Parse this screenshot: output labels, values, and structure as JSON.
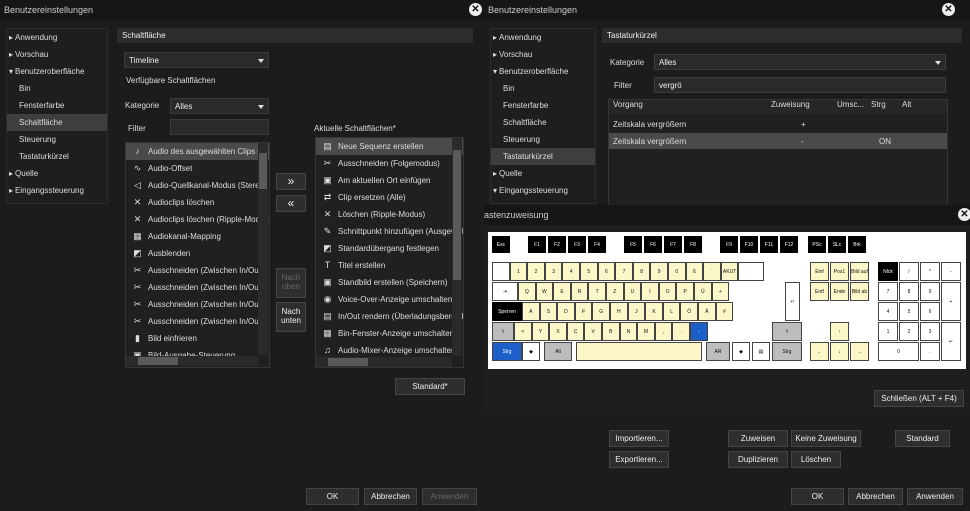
{
  "left_dialog": {
    "title": "Benutzereinstellungen",
    "nav": [
      {
        "label": "Anwendung",
        "level": 0,
        "arrow": "▸"
      },
      {
        "label": "Vorschau",
        "level": 0,
        "arrow": "▸"
      },
      {
        "label": "Benutzeroberfläche",
        "level": 0,
        "arrow": "▾"
      },
      {
        "label": "Bin",
        "level": 1
      },
      {
        "label": "Fensterfarbe",
        "level": 1
      },
      {
        "label": "Schaltfläche",
        "level": 1,
        "selected": true
      },
      {
        "label": "Steuerung",
        "level": 1
      },
      {
        "label": "Tastaturkürzel",
        "level": 1
      },
      {
        "label": "Quelle",
        "level": 0,
        "arrow": "▸"
      },
      {
        "label": "Eingangssteuerung",
        "level": 0,
        "arrow": "▸"
      }
    ],
    "section_title": "Schaltfläche",
    "timeline_combo": "Timeline",
    "available_label": "Verfügbare Schaltflächen",
    "category_label": "Kategorie",
    "category_value": "Alles",
    "filter_label": "Filter",
    "filter_value": "",
    "available_items": [
      {
        "label": "Audio des ausgewählten Clips ersetzen",
        "icon": "♪"
      },
      {
        "label": "Audio-Offset",
        "icon": "∿"
      },
      {
        "label": "Audio-Quellkanal-Modus (Stereo)",
        "icon": "◁"
      },
      {
        "label": "Audioclips löschen",
        "icon": "✕"
      },
      {
        "label": "Audioclips löschen (Ripple-Modus)",
        "icon": "✕"
      },
      {
        "label": "Audiokanal-Mapping",
        "icon": "▦"
      },
      {
        "label": "Ausblenden",
        "icon": "◩"
      },
      {
        "label": "Ausschneiden (Zwischen In/Out)",
        "icon": "✂"
      },
      {
        "label": "Ausschneiden (Zwischen In/Out)",
        "icon": "✂"
      },
      {
        "label": "Ausschneiden (Zwischen In/Out)",
        "icon": "✂"
      },
      {
        "label": "Ausschneiden (Zwischen In/Out)",
        "icon": "✂"
      },
      {
        "label": "Bild einfrieren",
        "icon": "▮"
      },
      {
        "label": "Bild-Ausgabe-Steuerung",
        "icon": "▣"
      }
    ],
    "move_right": "»",
    "move_left": "«",
    "move_up": "Nach oben",
    "move_down": "Nach unten",
    "current_label": "Aktuelle Schaltflächen*",
    "current_items": [
      {
        "label": "Neue Sequenz erstellen",
        "icon": "▤"
      },
      {
        "label": "Ausschneiden (Folgemodus)",
        "icon": "✂"
      },
      {
        "label": "Am aktuellen Ort einfügen",
        "icon": "▣"
      },
      {
        "label": "Clip ersetzen (Alle)",
        "icon": "⇄"
      },
      {
        "label": "Löschen (Ripple-Modus)",
        "icon": "✕"
      },
      {
        "label": "Schnittpunkt hinzufügen (Ausgewählte Spur)",
        "icon": "✎"
      },
      {
        "label": "Standardübergang festlegen",
        "icon": "◩"
      },
      {
        "label": "Titel erstellen",
        "icon": "T"
      },
      {
        "label": "Standbild erstellen (Speichern)",
        "icon": "▣"
      },
      {
        "label": "Voice-Over-Anzeige umschalten",
        "icon": "◉"
      },
      {
        "label": "In/Out rendern (Überladungsbereich)",
        "icon": "▤"
      },
      {
        "label": "Bin-Fenster-Anzeige umschalten",
        "icon": "▦"
      },
      {
        "label": "Audio-Mixer-Anzeige umschalten",
        "icon": "♫"
      }
    ],
    "standard_button": "Standard*",
    "ok": "OK",
    "cancel": "Abbrechen",
    "apply": "Anwenden"
  },
  "right_dialog": {
    "title": "Benutzereinstellungen",
    "nav": [
      {
        "label": "Anwendung",
        "level": 0,
        "arrow": "▸"
      },
      {
        "label": "Vorschau",
        "level": 0,
        "arrow": "▸"
      },
      {
        "label": "Benutzeroberfläche",
        "level": 0,
        "arrow": "▾"
      },
      {
        "label": "Bin",
        "level": 1
      },
      {
        "label": "Fensterfarbe",
        "level": 1
      },
      {
        "label": "Schaltfläche",
        "level": 1
      },
      {
        "label": "Steuerung",
        "level": 1
      },
      {
        "label": "Tastaturkürzel",
        "level": 1,
        "selected": true
      },
      {
        "label": "Quelle",
        "level": 0,
        "arrow": "▸"
      },
      {
        "label": "Eingangssteuerung",
        "level": 0,
        "arrow": "▾"
      }
    ],
    "section_title": "Tastaturkürzel",
    "category_label": "Kategorie",
    "category_value": "Alles",
    "filter_label": "Filter",
    "filter_value": "vergrö",
    "table_headers": [
      "Vorgang",
      "Zuweisung",
      "Umsc...",
      "Strg",
      "Alt"
    ],
    "table_rows": [
      {
        "action": "Zeitskala vergrößern",
        "assign": "+",
        "shift": "",
        "ctrl": "",
        "alt": ""
      },
      {
        "action": "Zeitskala vergrößern",
        "assign": "-",
        "shift": "",
        "ctrl": "ON",
        "alt": ""
      }
    ],
    "import_btn": "Importieren...",
    "export_btn": "Exportieren...",
    "assign_btn": "Zuweisen",
    "no_assign_btn": "Keine Zuweisung",
    "duplicate_btn": "Duplizieren",
    "delete_btn": "Löschen",
    "standard_btn": "Standard",
    "ok": "OK",
    "cancel": "Abbrechen",
    "apply": "Anwenden"
  },
  "key_dialog": {
    "title": "astenzuweisung",
    "close_btn": "Schließen (ALT + F4)",
    "fn_row": [
      "Esc",
      "F1",
      "F2",
      "F3",
      "F4",
      "F5",
      "F6",
      "F7",
      "F8",
      "F9",
      "F10",
      "F11",
      "F12",
      "PSc",
      "SLc",
      "Brk"
    ],
    "row1": [
      "",
      "1",
      "2",
      "3",
      "4",
      "5",
      "6",
      "7",
      "8",
      "9",
      "0",
      "ß",
      "´",
      "AKUT",
      ""
    ],
    "row2": [
      "⇥",
      "Q",
      "W",
      "E",
      "R",
      "T",
      "Z",
      "U",
      "I",
      "O",
      "P",
      "Ü",
      "+"
    ],
    "row3": [
      "Sperren",
      "A",
      "S",
      "D",
      "F",
      "G",
      "H",
      "J",
      "K",
      "L",
      "Ö",
      "Ä",
      "#"
    ],
    "row4": [
      "⇧",
      "<",
      "Y",
      "X",
      "C",
      "V",
      "B",
      "N",
      "M",
      ",",
      ".",
      "-",
      "⇧"
    ],
    "row5": [
      "Strg",
      "◆",
      "Alt",
      "",
      "AR",
      "◆",
      "▤",
      "Strg"
    ],
    "nav_keys": [
      "Einf",
      "Pos1",
      "Bild auf",
      "Entf",
      "Ende",
      "Bild ab"
    ],
    "numpad_top": [
      "Nlck",
      "/",
      "*",
      "-"
    ],
    "numpad": [
      "7",
      "8",
      "9",
      "4",
      "5",
      "6",
      "1",
      "2",
      "3",
      "0",
      "."
    ],
    "numpad_side": [
      "+"
    ]
  },
  "colors": {
    "key_yellow": "#fbf7c8",
    "key_blue": "#1c5fc8",
    "selection": "#4a4a4a"
  }
}
